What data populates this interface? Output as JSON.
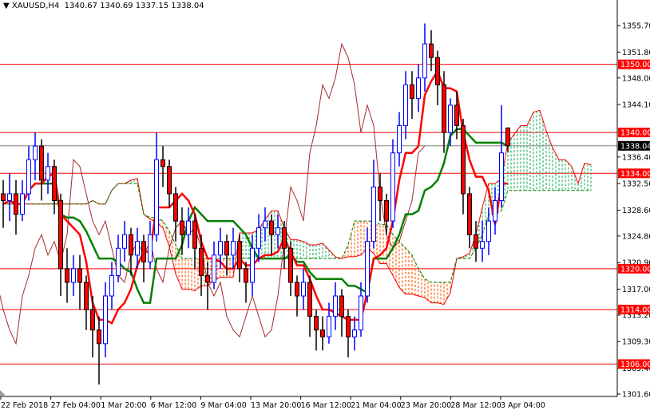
{
  "header": {
    "title": "▼ XAUUSD,H4  1340.67 1340.69 1337.15 1338.04"
  },
  "chart_data": {
    "type": "candlestick",
    "symbol": "XAUUSD",
    "timeframe": "H4",
    "ohlc_readout": [
      1340.67,
      1340.69,
      1337.15,
      1338.04
    ],
    "current_price": "1338.04",
    "ylim": [
      1301.6,
      1355.7
    ],
    "y_ticks": [
      "1355.70",
      "1351.80",
      "1348.00",
      "1344.10",
      "1336.40",
      "1332.50",
      "1328.60",
      "1324.80",
      "1320.90",
      "1317.00",
      "1313.20",
      "1309.30",
      "1305.40",
      "1301.60"
    ],
    "x_ticks": [
      "22 Feb 2018",
      "27 Feb 04:00",
      "1 Mar 20:00",
      "6 Mar 12:00",
      "9 Mar 04:00",
      "13 Mar 20:00",
      "16 Mar 12:00",
      "21 Mar 04:00",
      "23 Mar 20:00",
      "28 Mar 12:00",
      "3 Apr 04:00"
    ],
    "horizontal_levels": [
      "1350.00",
      "1340.00",
      "1334.00",
      "1320.00",
      "1314.00",
      "1306.00"
    ],
    "indicator": "Ichimoku Kinko Hyo",
    "colors": {
      "bull": "#0000ff",
      "bear_body": "#ff0000",
      "bear_outline": "#000000",
      "tenkan": "#ff0000",
      "kijun": "#008000",
      "chikou": "#a52a2a",
      "cloud_bull": "#2eb872",
      "cloud_bear": "#ff6a1a",
      "level": "#ff0000",
      "price_line": "#808080"
    },
    "candles": [
      [
        1331,
        1333,
        1326,
        1330
      ],
      [
        1330,
        1334,
        1327,
        1331
      ],
      [
        1331,
        1333,
        1325,
        1328
      ],
      [
        1328,
        1333,
        1327,
        1331
      ],
      [
        1331,
        1338,
        1330,
        1336
      ],
      [
        1336,
        1340,
        1333,
        1338
      ],
      [
        1338,
        1339,
        1330,
        1333
      ],
      [
        1333,
        1337,
        1331,
        1335
      ],
      [
        1335,
        1336,
        1328,
        1330
      ],
      [
        1330,
        1331,
        1316,
        1320
      ],
      [
        1320,
        1323,
        1315,
        1318
      ],
      [
        1318,
        1322,
        1316,
        1320
      ],
      [
        1320,
        1322,
        1314,
        1318
      ],
      [
        1318,
        1319,
        1311,
        1314
      ],
      [
        1314,
        1316,
        1307,
        1311
      ],
      [
        1311,
        1313,
        1303,
        1309
      ],
      [
        1309,
        1318,
        1307,
        1316
      ],
      [
        1316,
        1321,
        1314,
        1319
      ],
      [
        1319,
        1325,
        1318,
        1323
      ],
      [
        1323,
        1327,
        1321,
        1325
      ],
      [
        1325,
        1326,
        1319,
        1322
      ],
      [
        1322,
        1326,
        1320,
        1324
      ],
      [
        1324,
        1325,
        1318,
        1321
      ],
      [
        1321,
        1327,
        1320,
        1325
      ],
      [
        1325,
        1340,
        1324,
        1336
      ],
      [
        1336,
        1338,
        1332,
        1335
      ],
      [
        1335,
        1336,
        1329,
        1331
      ],
      [
        1331,
        1332,
        1324,
        1327
      ],
      [
        1327,
        1329,
        1322,
        1325
      ],
      [
        1325,
        1329,
        1323,
        1327
      ],
      [
        1327,
        1328,
        1320,
        1323
      ],
      [
        1323,
        1325,
        1316,
        1319
      ],
      [
        1319,
        1321,
        1314,
        1318
      ],
      [
        1318,
        1324,
        1317,
        1322
      ],
      [
        1322,
        1326,
        1320,
        1324
      ],
      [
        1324,
        1325,
        1319,
        1322
      ],
      [
        1322,
        1326,
        1320,
        1324
      ],
      [
        1324,
        1325,
        1318,
        1320
      ],
      [
        1320,
        1321,
        1315,
        1318
      ],
      [
        1318,
        1325,
        1316,
        1323
      ],
      [
        1323,
        1328,
        1321,
        1326
      ],
      [
        1326,
        1329,
        1324,
        1327
      ],
      [
        1327,
        1328,
        1322,
        1325
      ],
      [
        1325,
        1328,
        1323,
        1326
      ],
      [
        1326,
        1327,
        1320,
        1323
      ],
      [
        1323,
        1324,
        1316,
        1318
      ],
      [
        1318,
        1319,
        1313,
        1316
      ],
      [
        1316,
        1320,
        1314,
        1318
      ],
      [
        1318,
        1319,
        1310,
        1313
      ],
      [
        1313,
        1314,
        1308,
        1311
      ],
      [
        1311,
        1313,
        1308,
        1310
      ],
      [
        1310,
        1315,
        1309,
        1313
      ],
      [
        1313,
        1318,
        1311,
        1316
      ],
      [
        1316,
        1317,
        1310,
        1313
      ],
      [
        1313,
        1314,
        1307,
        1310
      ],
      [
        1310,
        1313,
        1308,
        1311
      ],
      [
        1311,
        1318,
        1310,
        1316
      ],
      [
        1316,
        1326,
        1315,
        1324
      ],
      [
        1324,
        1336,
        1323,
        1332
      ],
      [
        1332,
        1334,
        1327,
        1330
      ],
      [
        1330,
        1331,
        1325,
        1327
      ],
      [
        1327,
        1339,
        1326,
        1337
      ],
      [
        1337,
        1343,
        1335,
        1341
      ],
      [
        1341,
        1349,
        1339,
        1347
      ],
      [
        1347,
        1349,
        1342,
        1345
      ],
      [
        1345,
        1350,
        1343,
        1348
      ],
      [
        1348,
        1356,
        1346,
        1353
      ],
      [
        1353,
        1355,
        1349,
        1351
      ],
      [
        1351,
        1352,
        1344,
        1347
      ],
      [
        1347,
        1349,
        1337,
        1340
      ],
      [
        1340,
        1345,
        1338,
        1344
      ],
      [
        1344,
        1346,
        1339,
        1341
      ],
      [
        1341,
        1342,
        1328,
        1331
      ],
      [
        1331,
        1332,
        1323,
        1325
      ],
      [
        1325,
        1327,
        1321,
        1323
      ],
      [
        1323,
        1327,
        1321,
        1324
      ],
      [
        1324,
        1329,
        1322,
        1327
      ],
      [
        1327,
        1332,
        1325,
        1330
      ],
      [
        1330,
        1344,
        1329,
        1337
      ],
      [
        1340.67,
        1340.69,
        1337.15,
        1338.04
      ]
    ]
  }
}
